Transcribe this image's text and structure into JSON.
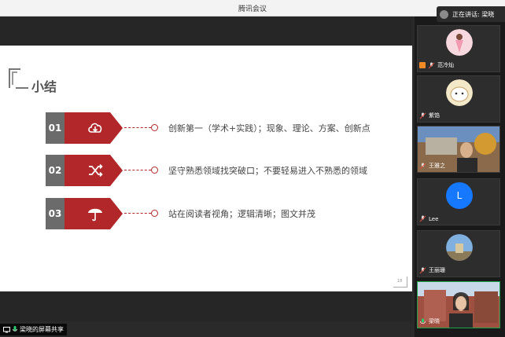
{
  "window": {
    "title": "腾讯会议"
  },
  "speaking": {
    "text": "正在讲话: 梁晓"
  },
  "slide": {
    "heading": "小结",
    "page_number": "18",
    "items": [
      {
        "num": "01",
        "icon": "cloud-download-icon",
        "text": "创新第一（学术+实践）；现象、理论、方案、创新点"
      },
      {
        "num": "02",
        "icon": "shuffle-icon",
        "text": "坚守熟悉领域找突破口；不要轻易进入不熟悉的领域"
      },
      {
        "num": "03",
        "icon": "umbrella-icon",
        "text": "站在阅读者视角；逻辑清晰；图文并茂"
      }
    ]
  },
  "share_label": {
    "text": "梁晓的屏幕共享"
  },
  "participants": [
    {
      "name": "范冷灿",
      "avatar": "pink-figure",
      "host": true
    },
    {
      "name": "紫馅",
      "avatar": "cartoon"
    },
    {
      "name": "王雅之",
      "avatar": "video-man"
    },
    {
      "name": "Lee",
      "avatar": "letter",
      "initial": "L"
    },
    {
      "name": "王丽珊",
      "avatar": "photo-sky"
    },
    {
      "name": "梁晓",
      "avatar": "video-woman",
      "active": true
    }
  ],
  "colors": {
    "accent_red": "#b2282a",
    "accent_green": "#1fa34a",
    "avatar_blue": "#1677ff"
  }
}
